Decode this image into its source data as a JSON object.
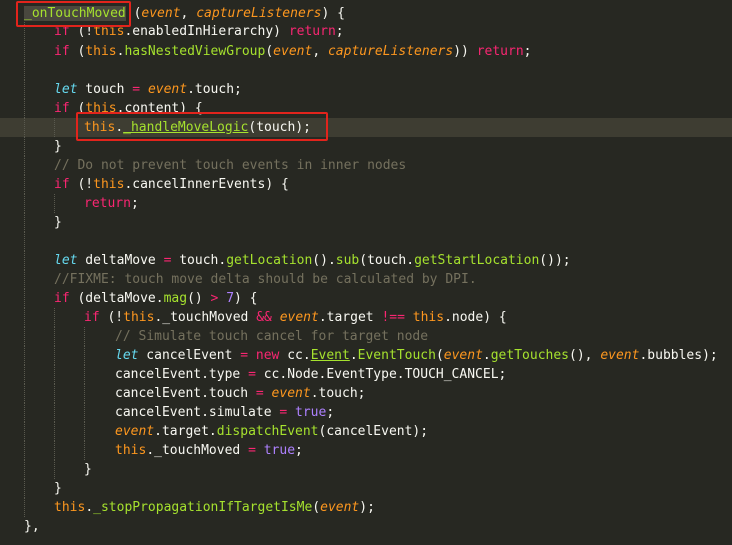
{
  "theme": {
    "background": "#272822",
    "keyword": "#f92672",
    "function": "#a6e22e",
    "this": "#fd971f",
    "comment": "#75715e",
    "number": "#ae81ff",
    "storage": "#66d9ef",
    "annotation_box": "#e2241c"
  },
  "code": {
    "lines": [
      [
        [
          "fn sel",
          "_onTouchMoved"
        ],
        [
          "pl",
          " ("
        ],
        [
          "pr",
          "event"
        ],
        [
          "pl",
          ", "
        ],
        [
          "pr",
          "captureListeners"
        ],
        [
          "pl",
          ") {"
        ]
      ],
      [
        [
          "kw",
          "if"
        ],
        [
          "pl",
          " (!"
        ],
        [
          "th",
          "this"
        ],
        [
          "pl",
          ".enabledInHierarchy) "
        ],
        [
          "kw",
          "return"
        ],
        [
          "pl",
          ";"
        ]
      ],
      [
        [
          "kw",
          "if"
        ],
        [
          "pl",
          " ("
        ],
        [
          "th",
          "this"
        ],
        [
          "pl",
          "."
        ],
        [
          "fn",
          "hasNestedViewGroup"
        ],
        [
          "pl",
          "("
        ],
        [
          "pr",
          "event"
        ],
        [
          "pl",
          ", "
        ],
        [
          "pr",
          "captureListeners"
        ],
        [
          "pl",
          ")) "
        ],
        [
          "kw",
          "return"
        ],
        [
          "pl",
          ";"
        ]
      ],
      [],
      [
        [
          "st",
          "let"
        ],
        [
          "pl",
          " touch "
        ],
        [
          "kw",
          "="
        ],
        [
          "pl",
          " "
        ],
        [
          "pr",
          "event"
        ],
        [
          "pl",
          ".touch;"
        ]
      ],
      [
        [
          "kw",
          "if"
        ],
        [
          "pl",
          " ("
        ],
        [
          "th",
          "this"
        ],
        [
          "pl",
          ".content) {"
        ]
      ],
      [
        [
          "th",
          "this"
        ],
        [
          "pl",
          "."
        ],
        [
          "fn ul",
          "_handleMoveLogic"
        ],
        [
          "pl",
          "(touch);"
        ]
      ],
      [
        [
          "pl",
          "}"
        ]
      ],
      [
        [
          "cm",
          "// Do not prevent touch events in inner nodes"
        ]
      ],
      [
        [
          "kw",
          "if"
        ],
        [
          "pl",
          " (!"
        ],
        [
          "th",
          "this"
        ],
        [
          "pl",
          ".cancelInnerEvents) {"
        ]
      ],
      [
        [
          "kw",
          "return"
        ],
        [
          "pl",
          ";"
        ]
      ],
      [
        [
          "pl",
          "}"
        ]
      ],
      [],
      [
        [
          "st",
          "let"
        ],
        [
          "pl",
          " deltaMove "
        ],
        [
          "kw",
          "="
        ],
        [
          "pl",
          " touch."
        ],
        [
          "fn",
          "getLocation"
        ],
        [
          "pl",
          "()."
        ],
        [
          "fn",
          "sub"
        ],
        [
          "pl",
          "(touch."
        ],
        [
          "fn",
          "getStartLocation"
        ],
        [
          "pl",
          "());"
        ]
      ],
      [
        [
          "cm",
          "//FIXME: touch move delta should be calculated by DPI."
        ]
      ],
      [
        [
          "kw",
          "if"
        ],
        [
          "pl",
          " (deltaMove."
        ],
        [
          "fn",
          "mag"
        ],
        [
          "pl",
          "() "
        ],
        [
          "kw",
          ">"
        ],
        [
          "pl",
          " "
        ],
        [
          "nu",
          "7"
        ],
        [
          "pl",
          ") {"
        ]
      ],
      [
        [
          "kw",
          "if"
        ],
        [
          "pl",
          " (!"
        ],
        [
          "th",
          "this"
        ],
        [
          "pl",
          "._touchMoved "
        ],
        [
          "kw",
          "&&"
        ],
        [
          "pl",
          " "
        ],
        [
          "pr",
          "event"
        ],
        [
          "pl",
          ".target "
        ],
        [
          "kw",
          "!=="
        ],
        [
          "pl",
          " "
        ],
        [
          "th",
          "this"
        ],
        [
          "pl",
          ".node) {"
        ]
      ],
      [
        [
          "cm",
          "// Simulate touch cancel for target node"
        ]
      ],
      [
        [
          "st",
          "let"
        ],
        [
          "pl",
          " cancelEvent "
        ],
        [
          "kw",
          "="
        ],
        [
          "pl",
          " "
        ],
        [
          "kw",
          "new"
        ],
        [
          "pl",
          " cc."
        ],
        [
          "fn ul",
          "Event"
        ],
        [
          "pl",
          "."
        ],
        [
          "fn",
          "EventTouch"
        ],
        [
          "pl",
          "("
        ],
        [
          "pr",
          "event"
        ],
        [
          "pl",
          "."
        ],
        [
          "fn",
          "getTouches"
        ],
        [
          "pl",
          "(), "
        ],
        [
          "pr",
          "event"
        ],
        [
          "pl",
          ".bubbles);"
        ]
      ],
      [
        [
          "pl",
          "cancelEvent.type "
        ],
        [
          "kw",
          "="
        ],
        [
          "pl",
          " cc.Node.EventType.TOUCH_CANCEL;"
        ]
      ],
      [
        [
          "pl",
          "cancelEvent.touch "
        ],
        [
          "kw",
          "="
        ],
        [
          "pl",
          " "
        ],
        [
          "pr",
          "event"
        ],
        [
          "pl",
          ".touch;"
        ]
      ],
      [
        [
          "pl",
          "cancelEvent.simulate "
        ],
        [
          "kw",
          "="
        ],
        [
          "pl",
          " "
        ],
        [
          "nu",
          "true"
        ],
        [
          "pl",
          ";"
        ]
      ],
      [
        [
          "pr",
          "event"
        ],
        [
          "pl",
          ".target."
        ],
        [
          "fn",
          "dispatchEvent"
        ],
        [
          "pl",
          "(cancelEvent);"
        ]
      ],
      [
        [
          "th",
          "this"
        ],
        [
          "pl",
          "._touchMoved "
        ],
        [
          "kw",
          "="
        ],
        [
          "pl",
          " "
        ],
        [
          "nu",
          "true"
        ],
        [
          "pl",
          ";"
        ]
      ],
      [
        [
          "pl",
          "}"
        ]
      ],
      [
        [
          "pl",
          "}"
        ]
      ],
      [
        [
          "th",
          "this"
        ],
        [
          "pl",
          "."
        ],
        [
          "fn",
          "_stopPropagationIfTargetIsMe"
        ],
        [
          "pl",
          "("
        ],
        [
          "pr",
          "event"
        ],
        [
          "pl",
          ");"
        ]
      ],
      [
        [
          "pl",
          "},"
        ]
      ]
    ]
  }
}
